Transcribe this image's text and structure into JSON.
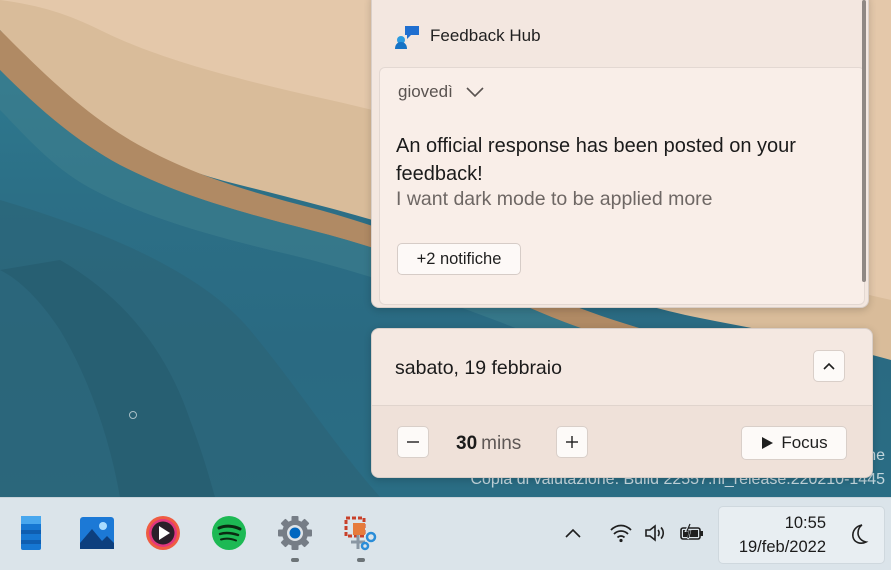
{
  "desktop": {
    "watermark_line1": "ne",
    "watermark_line2": "Copia di valutazione. Build 22557.ni_release.220210-1445"
  },
  "notification_center": {
    "app_name": "Feedback Hub",
    "day_label": "giovedì",
    "title": "An official response has been posted on your feedback!",
    "body": "I want dark mode to be applied more",
    "more_button": "+2 notifiche"
  },
  "calendar": {
    "date": "sabato, 19 febbraio",
    "focus_value": "30",
    "focus_unit": "mins",
    "focus_button": "Focus"
  },
  "taskbar": {
    "apps": [
      "widgets-icon",
      "photos-icon",
      "media-player-icon",
      "spotify-icon",
      "settings-icon",
      "snipping-tool-icon"
    ],
    "time": "10:55",
    "date": "19/feb/2022"
  },
  "colors": {
    "panel_bg": "#f3e7e0",
    "taskbar_bg": "#dbe4ea",
    "spotify_green": "#1db954",
    "settings_accent": "#0067c0"
  }
}
